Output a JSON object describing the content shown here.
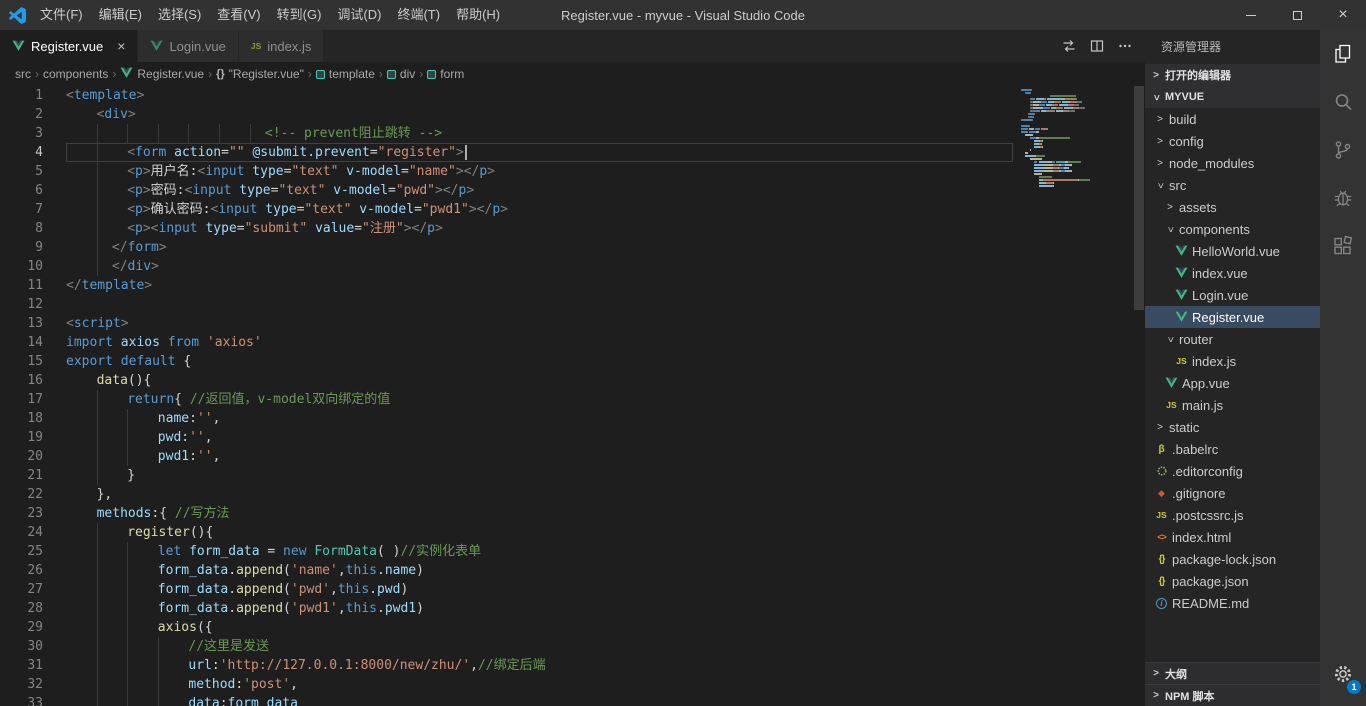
{
  "titlebar": {
    "menus": [
      "文件(F)",
      "编辑(E)",
      "选择(S)",
      "查看(V)",
      "转到(G)",
      "调试(D)",
      "终端(T)",
      "帮助(H)"
    ],
    "title": "Register.vue - myvue - Visual Studio Code"
  },
  "tabbar": {
    "tabs": [
      {
        "label": "Register.vue",
        "icon": "vue",
        "active": true,
        "closable": true
      },
      {
        "label": "Login.vue",
        "icon": "vue",
        "active": false,
        "closable": false
      },
      {
        "label": "index.js",
        "icon": "js",
        "active": false,
        "closable": false
      }
    ],
    "actions": [
      {
        "name": "compare-changes-icon"
      },
      {
        "name": "split-editor-icon"
      },
      {
        "name": "more-actions-icon"
      }
    ]
  },
  "breadcrumb": {
    "separator": "›",
    "items": [
      {
        "label": "src",
        "icon": null
      },
      {
        "label": "components",
        "icon": null
      },
      {
        "label": "Register.vue",
        "icon": "vue"
      },
      {
        "label": "\"Register.vue\"",
        "icon": "braces"
      },
      {
        "label": "template",
        "icon": "symbol"
      },
      {
        "label": "div",
        "icon": "symbol"
      },
      {
        "label": "form",
        "icon": "symbol"
      }
    ]
  },
  "editor": {
    "current_line": 4,
    "token_colors": {
      "pun": "#808080",
      "tag": "#569cd6",
      "attr": "#9cdcfe",
      "str": "#ce9178",
      "txt": "#d4d4d4",
      "cmt": "#6a9955",
      "kw": "#569cd6",
      "fn": "#dcdcaa",
      "cls": "#4ec9b0",
      "var": "#9cdcfe"
    },
    "lines": [
      {
        "n": 1,
        "i": 0,
        "t": [
          [
            "pun",
            "<"
          ],
          [
            "tag",
            "template"
          ],
          [
            "pun",
            ">"
          ]
        ]
      },
      {
        "n": 2,
        "i": 4,
        "t": [
          [
            "pun",
            "<"
          ],
          [
            "tag",
            "div"
          ],
          [
            "pun",
            ">"
          ]
        ]
      },
      {
        "n": 3,
        "i": 26,
        "t": [
          [
            "cmt",
            "<!-- prevent阻止跳转 -->"
          ]
        ]
      },
      {
        "n": 4,
        "i": 8,
        "t": [
          [
            "pun",
            "<"
          ],
          [
            "tag",
            "form"
          ],
          [
            "txt",
            " "
          ],
          [
            "attr",
            "action"
          ],
          [
            "txt",
            "="
          ],
          [
            "str",
            "\"\""
          ],
          [
            "txt",
            " "
          ],
          [
            "attr",
            "@submit.prevent"
          ],
          [
            "txt",
            "="
          ],
          [
            "str",
            "\"register\""
          ],
          [
            "pun",
            ">"
          ]
        ]
      },
      {
        "n": 5,
        "i": 8,
        "t": [
          [
            "pun",
            "<"
          ],
          [
            "tag",
            "p"
          ],
          [
            "pun",
            ">"
          ],
          [
            "txt",
            "用户名:"
          ],
          [
            "pun",
            "<"
          ],
          [
            "tag",
            "input"
          ],
          [
            "txt",
            " "
          ],
          [
            "attr",
            "type"
          ],
          [
            "txt",
            "="
          ],
          [
            "str",
            "\"text\""
          ],
          [
            "txt",
            " "
          ],
          [
            "attr",
            "v-model"
          ],
          [
            "txt",
            "="
          ],
          [
            "str",
            "\"name\""
          ],
          [
            "pun",
            "></"
          ],
          [
            "tag",
            "p"
          ],
          [
            "pun",
            ">"
          ]
        ]
      },
      {
        "n": 6,
        "i": 8,
        "t": [
          [
            "pun",
            "<"
          ],
          [
            "tag",
            "p"
          ],
          [
            "pun",
            ">"
          ],
          [
            "txt",
            "密码:"
          ],
          [
            "pun",
            "<"
          ],
          [
            "tag",
            "input"
          ],
          [
            "txt",
            " "
          ],
          [
            "attr",
            "type"
          ],
          [
            "txt",
            "="
          ],
          [
            "str",
            "\"text\""
          ],
          [
            "txt",
            " "
          ],
          [
            "attr",
            "v-model"
          ],
          [
            "txt",
            "="
          ],
          [
            "str",
            "\"pwd\""
          ],
          [
            "pun",
            "></"
          ],
          [
            "tag",
            "p"
          ],
          [
            "pun",
            ">"
          ]
        ]
      },
      {
        "n": 7,
        "i": 8,
        "t": [
          [
            "pun",
            "<"
          ],
          [
            "tag",
            "p"
          ],
          [
            "pun",
            ">"
          ],
          [
            "txt",
            "确认密码:"
          ],
          [
            "pun",
            "<"
          ],
          [
            "tag",
            "input"
          ],
          [
            "txt",
            " "
          ],
          [
            "attr",
            "type"
          ],
          [
            "txt",
            "="
          ],
          [
            "str",
            "\"text\""
          ],
          [
            "txt",
            " "
          ],
          [
            "attr",
            "v-model"
          ],
          [
            "txt",
            "="
          ],
          [
            "str",
            "\"pwd1\""
          ],
          [
            "pun",
            "></"
          ],
          [
            "tag",
            "p"
          ],
          [
            "pun",
            ">"
          ]
        ]
      },
      {
        "n": 8,
        "i": 8,
        "t": [
          [
            "pun",
            "<"
          ],
          [
            "tag",
            "p"
          ],
          [
            "pun",
            "><"
          ],
          [
            "tag",
            "input"
          ],
          [
            "txt",
            " "
          ],
          [
            "attr",
            "type"
          ],
          [
            "txt",
            "="
          ],
          [
            "str",
            "\"submit\""
          ],
          [
            "txt",
            " "
          ],
          [
            "attr",
            "value"
          ],
          [
            "txt",
            "="
          ],
          [
            "str",
            "\"注册\""
          ],
          [
            "pun",
            "></"
          ],
          [
            "tag",
            "p"
          ],
          [
            "pun",
            ">"
          ]
        ]
      },
      {
        "n": 9,
        "i": 6,
        "t": [
          [
            "pun",
            "</"
          ],
          [
            "tag",
            "form"
          ],
          [
            "pun",
            ">"
          ]
        ]
      },
      {
        "n": 10,
        "i": 6,
        "t": [
          [
            "pun",
            "</"
          ],
          [
            "tag",
            "div"
          ],
          [
            "pun",
            ">"
          ]
        ]
      },
      {
        "n": 11,
        "i": 0,
        "t": [
          [
            "pun",
            "</"
          ],
          [
            "tag",
            "template"
          ],
          [
            "pun",
            ">"
          ]
        ]
      },
      {
        "n": 12,
        "i": 0,
        "t": []
      },
      {
        "n": 13,
        "i": 0,
        "t": [
          [
            "pun",
            "<"
          ],
          [
            "tag",
            "script"
          ],
          [
            "pun",
            ">"
          ]
        ]
      },
      {
        "n": 14,
        "i": 0,
        "t": [
          [
            "kw",
            "import"
          ],
          [
            "txt",
            " "
          ],
          [
            "var",
            "axios"
          ],
          [
            "txt",
            " "
          ],
          [
            "kw",
            "from"
          ],
          [
            "txt",
            " "
          ],
          [
            "str",
            "'axios'"
          ]
        ]
      },
      {
        "n": 15,
        "i": 0,
        "t": [
          [
            "kw",
            "export"
          ],
          [
            "txt",
            " "
          ],
          [
            "kw",
            "default"
          ],
          [
            "txt",
            " {"
          ]
        ]
      },
      {
        "n": 16,
        "i": 4,
        "t": [
          [
            "fn",
            "data"
          ],
          [
            "txt",
            "(){"
          ]
        ]
      },
      {
        "n": 17,
        "i": 8,
        "t": [
          [
            "kw",
            "return"
          ],
          [
            "txt",
            "{ "
          ],
          [
            "cmt",
            "//返回值，v-model双向绑定的值"
          ]
        ]
      },
      {
        "n": 18,
        "i": 12,
        "t": [
          [
            "var",
            "name"
          ],
          [
            "txt",
            ":"
          ],
          [
            "str",
            "''"
          ],
          [
            "txt",
            ","
          ]
        ]
      },
      {
        "n": 19,
        "i": 12,
        "t": [
          [
            "var",
            "pwd"
          ],
          [
            "txt",
            ":"
          ],
          [
            "str",
            "''"
          ],
          [
            "txt",
            ","
          ]
        ]
      },
      {
        "n": 20,
        "i": 12,
        "t": [
          [
            "var",
            "pwd1"
          ],
          [
            "txt",
            ":"
          ],
          [
            "str",
            "''"
          ],
          [
            "txt",
            ","
          ]
        ]
      },
      {
        "n": 21,
        "i": 8,
        "t": [
          [
            "txt",
            "}"
          ]
        ]
      },
      {
        "n": 22,
        "i": 4,
        "t": [
          [
            "txt",
            "},"
          ]
        ]
      },
      {
        "n": 23,
        "i": 4,
        "t": [
          [
            "var",
            "methods"
          ],
          [
            "txt",
            ":{ "
          ],
          [
            "cmt",
            "//写方法"
          ]
        ]
      },
      {
        "n": 24,
        "i": 8,
        "t": [
          [
            "fn",
            "register"
          ],
          [
            "txt",
            "(){"
          ]
        ]
      },
      {
        "n": 25,
        "i": 12,
        "t": [
          [
            "kw",
            "let"
          ],
          [
            "txt",
            " "
          ],
          [
            "var",
            "form_data"
          ],
          [
            "txt",
            " = "
          ],
          [
            "kw",
            "new"
          ],
          [
            "txt",
            " "
          ],
          [
            "cls",
            "FormData"
          ],
          [
            "txt",
            "( )"
          ],
          [
            "cmt",
            "//实例化表单"
          ]
        ]
      },
      {
        "n": 26,
        "i": 12,
        "t": [
          [
            "var",
            "form_data"
          ],
          [
            "txt",
            "."
          ],
          [
            "fn",
            "append"
          ],
          [
            "txt",
            "("
          ],
          [
            "str",
            "'name'"
          ],
          [
            "txt",
            ","
          ],
          [
            "kw",
            "this"
          ],
          [
            "txt",
            "."
          ],
          [
            "var",
            "name"
          ],
          [
            "txt",
            ")"
          ]
        ]
      },
      {
        "n": 27,
        "i": 12,
        "t": [
          [
            "var",
            "form_data"
          ],
          [
            "txt",
            "."
          ],
          [
            "fn",
            "append"
          ],
          [
            "txt",
            "("
          ],
          [
            "str",
            "'pwd'"
          ],
          [
            "txt",
            ","
          ],
          [
            "kw",
            "this"
          ],
          [
            "txt",
            "."
          ],
          [
            "var",
            "pwd"
          ],
          [
            "txt",
            ")"
          ]
        ]
      },
      {
        "n": 28,
        "i": 12,
        "t": [
          [
            "var",
            "form_data"
          ],
          [
            "txt",
            "."
          ],
          [
            "fn",
            "append"
          ],
          [
            "txt",
            "("
          ],
          [
            "str",
            "'pwd1'"
          ],
          [
            "txt",
            ","
          ],
          [
            "kw",
            "this"
          ],
          [
            "txt",
            "."
          ],
          [
            "var",
            "pwd1"
          ],
          [
            "txt",
            ")"
          ]
        ]
      },
      {
        "n": 29,
        "i": 12,
        "t": [
          [
            "fn",
            "axios"
          ],
          [
            "txt",
            "({"
          ]
        ]
      },
      {
        "n": 30,
        "i": 16,
        "t": [
          [
            "cmt",
            "//这里是发送"
          ]
        ]
      },
      {
        "n": 31,
        "i": 16,
        "t": [
          [
            "var",
            "url"
          ],
          [
            "txt",
            ":"
          ],
          [
            "str",
            "'http://127.0.0.1:8000/new/zhu/'"
          ],
          [
            "txt",
            ","
          ],
          [
            "cmt",
            "//绑定后端"
          ]
        ]
      },
      {
        "n": 32,
        "i": 16,
        "t": [
          [
            "var",
            "method"
          ],
          [
            "txt",
            ":"
          ],
          [
            "str",
            "'post'"
          ],
          [
            "txt",
            ","
          ]
        ]
      },
      {
        "n": 33,
        "i": 16,
        "t": [
          [
            "var",
            "data"
          ],
          [
            "txt",
            ":"
          ],
          [
            "var",
            "form_data"
          ]
        ]
      }
    ]
  },
  "explorer": {
    "title": "资源管理器",
    "sections": {
      "open_editors": "打开的编辑器",
      "project": "MYVUE"
    },
    "tree": [
      {
        "label": "build",
        "type": "folder",
        "state": "collapsed",
        "depth": 0
      },
      {
        "label": "config",
        "type": "folder",
        "state": "collapsed",
        "depth": 0
      },
      {
        "label": "node_modules",
        "type": "folder",
        "state": "collapsed",
        "depth": 0
      },
      {
        "label": "src",
        "type": "folder",
        "state": "expanded",
        "depth": 0
      },
      {
        "label": "assets",
        "type": "folder",
        "state": "collapsed",
        "depth": 1
      },
      {
        "label": "components",
        "type": "folder",
        "state": "expanded",
        "depth": 1
      },
      {
        "label": "HelloWorld.vue",
        "type": "vue",
        "depth": 2
      },
      {
        "label": "index.vue",
        "type": "vue",
        "depth": 2
      },
      {
        "label": "Login.vue",
        "type": "vue",
        "depth": 2
      },
      {
        "label": "Register.vue",
        "type": "vue",
        "depth": 2,
        "selected": true
      },
      {
        "label": "router",
        "type": "folder",
        "state": "expanded",
        "depth": 1
      },
      {
        "label": "index.js",
        "type": "js",
        "depth": 2
      },
      {
        "label": "App.vue",
        "type": "vue",
        "depth": 1
      },
      {
        "label": "main.js",
        "type": "js",
        "depth": 1
      },
      {
        "label": "static",
        "type": "folder",
        "state": "collapsed",
        "depth": 0
      },
      {
        "label": ".babelrc",
        "type": "babel",
        "depth": 0
      },
      {
        "label": ".editorconfig",
        "type": "editorconfig",
        "depth": 0
      },
      {
        "label": ".gitignore",
        "type": "git",
        "depth": 0
      },
      {
        "label": ".postcssrc.js",
        "type": "js",
        "depth": 0
      },
      {
        "label": "index.html",
        "type": "html",
        "depth": 0
      },
      {
        "label": "package-lock.json",
        "type": "json",
        "depth": 0
      },
      {
        "label": "package.json",
        "type": "json",
        "depth": 0
      },
      {
        "label": "README.md",
        "type": "info",
        "depth": 0
      }
    ],
    "bottom_sections": [
      "大纲",
      "NPM 脚本"
    ]
  },
  "activitybar": {
    "items": [
      {
        "name": "explorer-icon",
        "active": true
      },
      {
        "name": "search-icon",
        "active": false
      },
      {
        "name": "source-control-icon",
        "active": false
      },
      {
        "name": "debug-icon",
        "active": false
      },
      {
        "name": "extensions-icon",
        "active": false
      }
    ],
    "settings": {
      "name": "settings-gear-icon",
      "badge": "1"
    }
  }
}
